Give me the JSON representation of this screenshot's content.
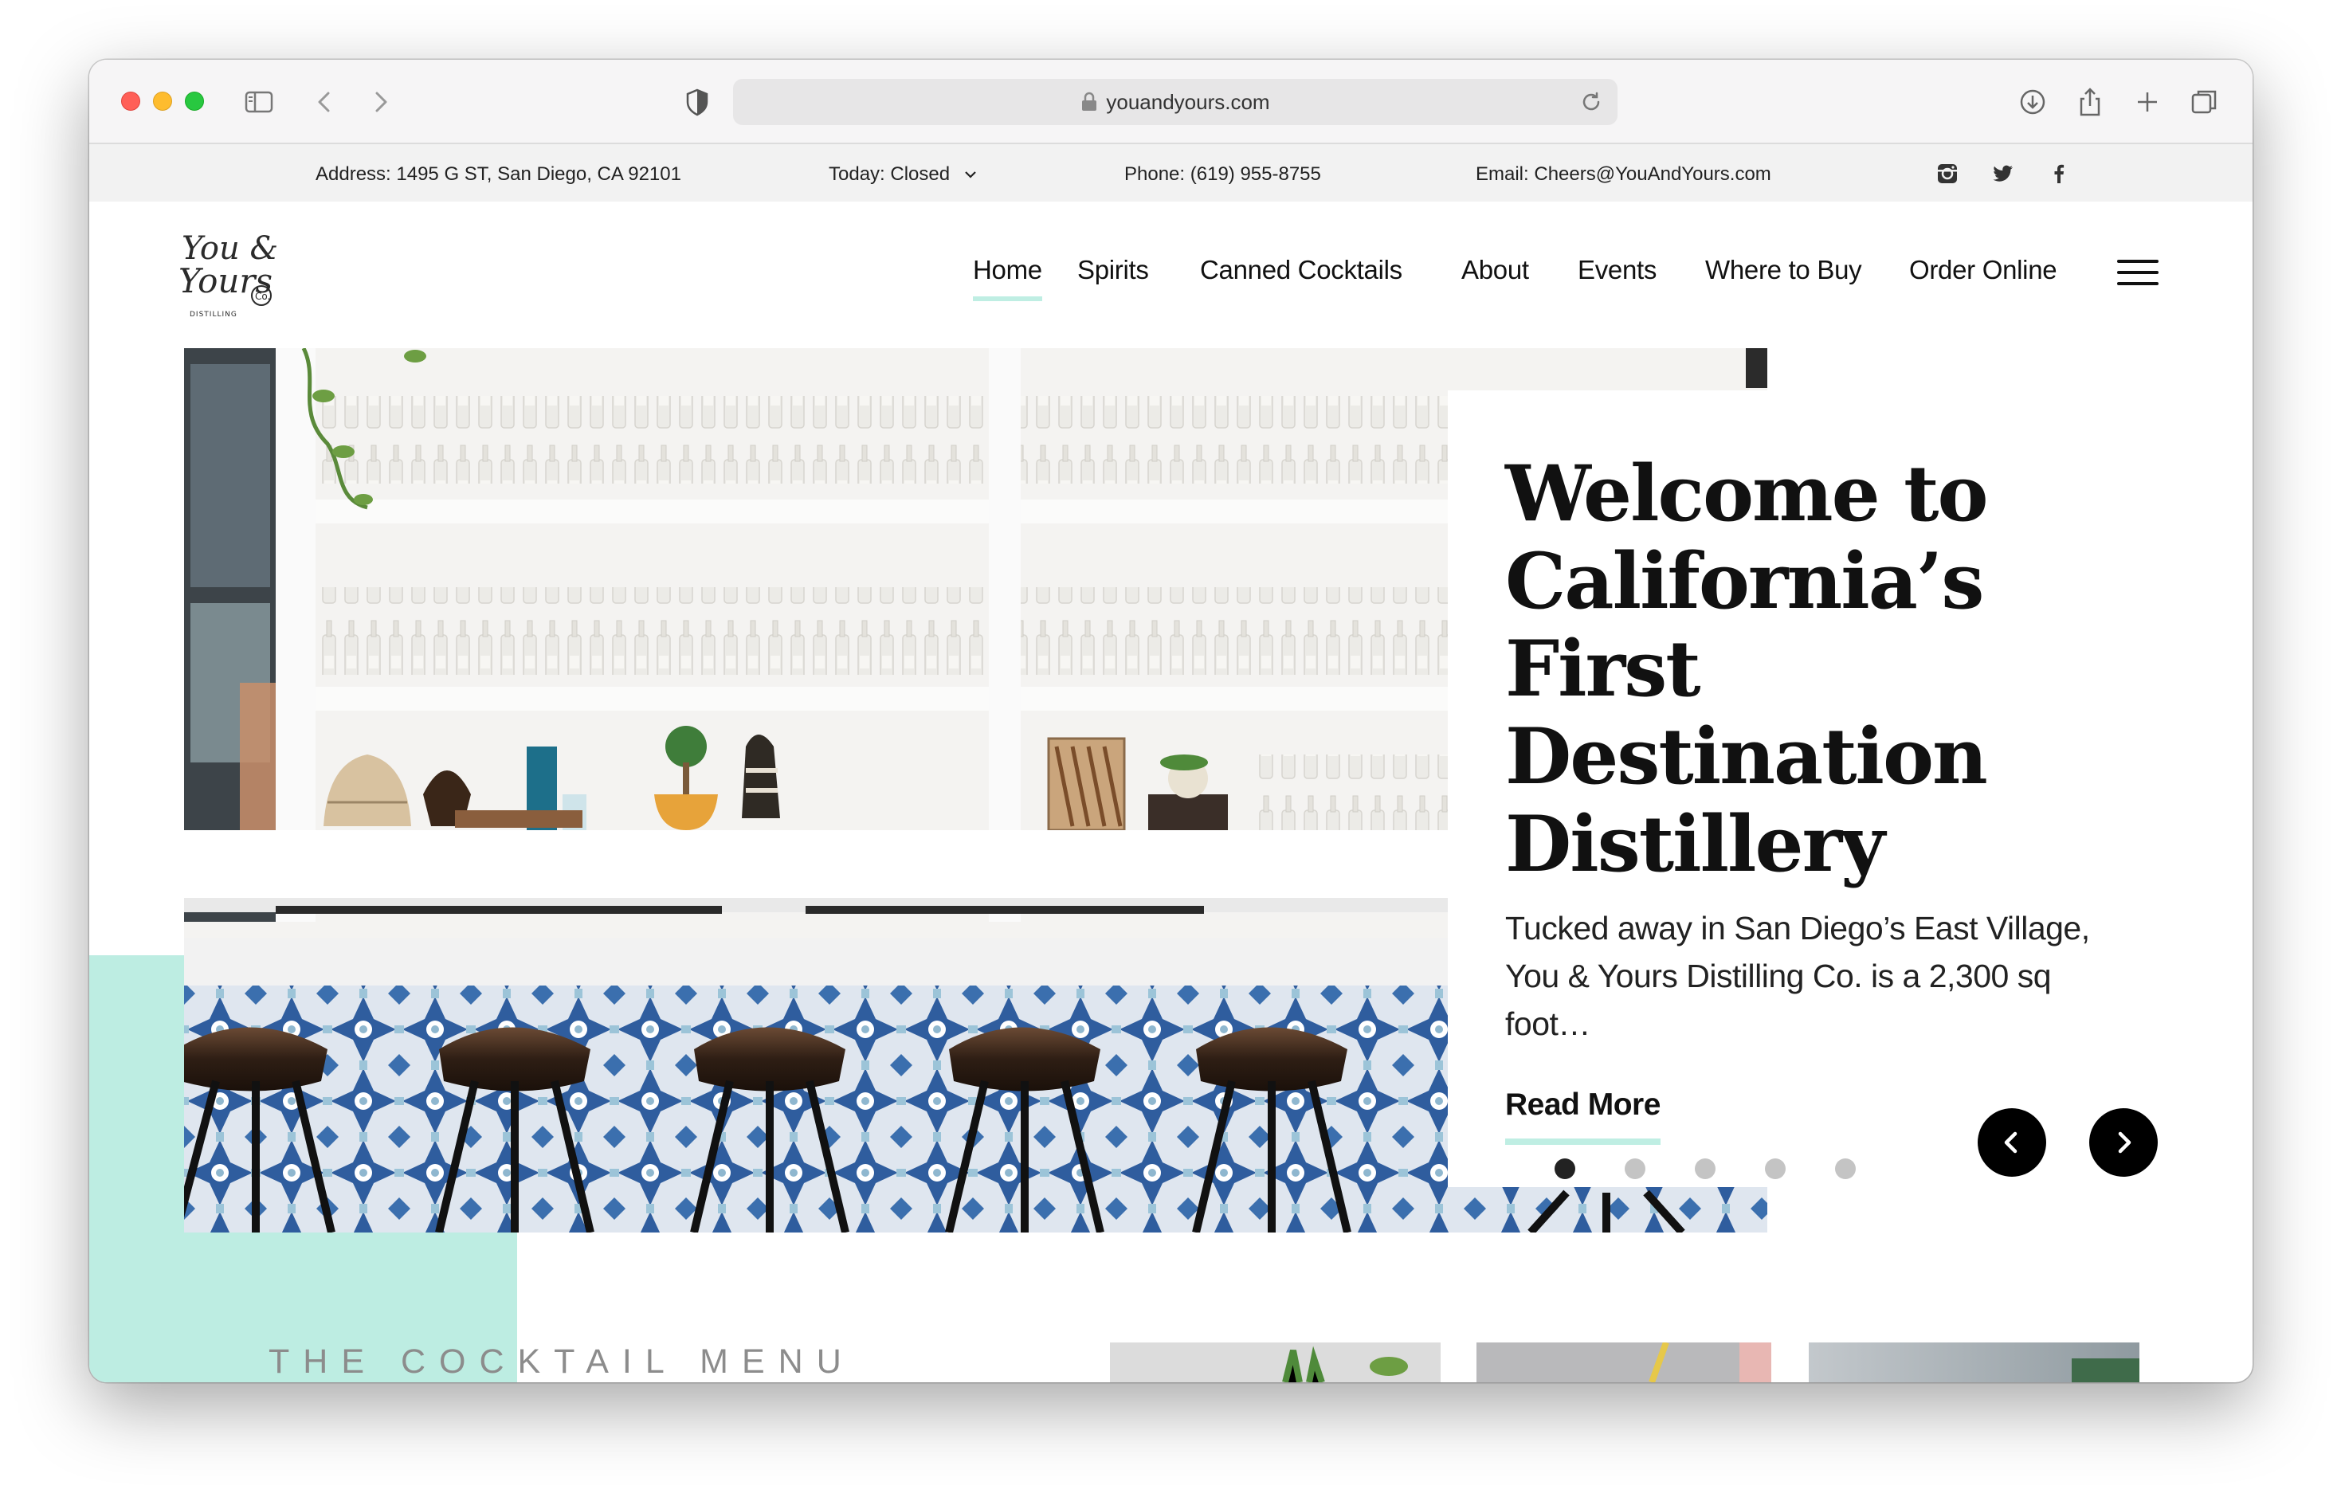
{
  "browser": {
    "url": "youandyours.com"
  },
  "infobar": {
    "address_label": "Address:",
    "address": "1495 G ST, San Diego, CA 92101",
    "hours": "Today: Closed",
    "phone_label": "Phone:",
    "phone": "(619) 955-8755",
    "email_label": "Email:",
    "email": "Cheers@YouAndYours.com",
    "social": [
      "instagram-icon",
      "twitter-icon",
      "facebook-icon"
    ]
  },
  "header": {
    "logo_text": [
      "You &",
      "Yours",
      "Co.",
      "DISTILLING"
    ],
    "nav": [
      {
        "label": "Home",
        "active": true
      },
      {
        "label": "Spirits",
        "active": false
      },
      {
        "label": "Canned Cocktails",
        "active": false
      },
      {
        "label": "About",
        "active": false
      },
      {
        "label": "Events",
        "active": false
      },
      {
        "label": "Where to Buy",
        "active": false
      },
      {
        "label": "Order Online",
        "active": false
      }
    ]
  },
  "hero": {
    "title": "Welcome to California’s First Destination Distillery",
    "text": "Tucked away in San Diego’s East Village, You & Yours Distilling Co. is a 2,300 sq foot…",
    "read_more": "Read More",
    "slides_total": 5,
    "active_slide": 1
  },
  "cocktail": {
    "title": "THE COCKTAIL MENU"
  },
  "colors": {
    "accent_mint": "#bdede2",
    "text_dark": "#111111",
    "tile_blue": "#2f5d9e"
  }
}
